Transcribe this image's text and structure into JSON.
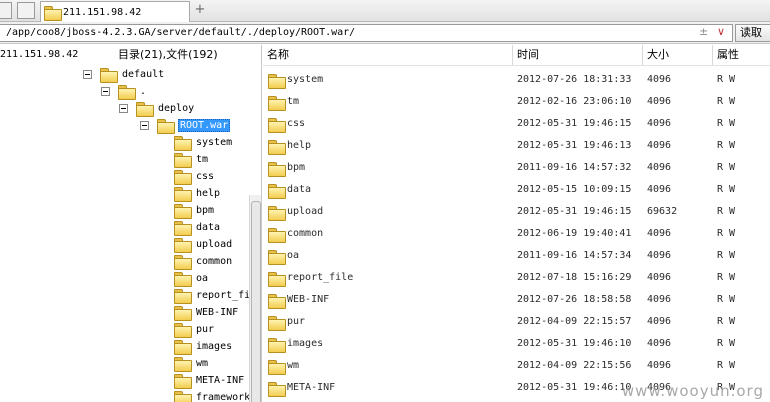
{
  "tabbar": {
    "tab_title": "211.151.98.42",
    "add_label": "+"
  },
  "address": {
    "path": "/app/coo8/jboss-4.2.3.GA/server/default/./deploy/ROOT.war/",
    "plusminus": "±",
    "dropdown": "∨",
    "read_label": "读取"
  },
  "left": {
    "host": "211.151.98.42",
    "counts": "目录(21),文件(192)",
    "tree": [
      {
        "label": "default",
        "expander": true,
        "selected": false
      },
      {
        "label": ".",
        "expander": true,
        "selected": false
      },
      {
        "label": "deploy",
        "expander": true,
        "selected": false
      },
      {
        "label": "ROOT.war",
        "expander": true,
        "selected": true
      },
      {
        "label": "system",
        "expander": false,
        "selected": false
      },
      {
        "label": "tm",
        "expander": false,
        "selected": false
      },
      {
        "label": "css",
        "expander": false,
        "selected": false
      },
      {
        "label": "help",
        "expander": false,
        "selected": false
      },
      {
        "label": "bpm",
        "expander": false,
        "selected": false
      },
      {
        "label": "data",
        "expander": false,
        "selected": false
      },
      {
        "label": "upload",
        "expander": false,
        "selected": false
      },
      {
        "label": "common",
        "expander": false,
        "selected": false
      },
      {
        "label": "oa",
        "expander": false,
        "selected": false
      },
      {
        "label": "report_fi",
        "expander": false,
        "selected": false
      },
      {
        "label": "WEB-INF",
        "expander": false,
        "selected": false
      },
      {
        "label": "pur",
        "expander": false,
        "selected": false
      },
      {
        "label": "images",
        "expander": false,
        "selected": false
      },
      {
        "label": "wm",
        "expander": false,
        "selected": false
      },
      {
        "label": "META-INF",
        "expander": false,
        "selected": false
      },
      {
        "label": "framework",
        "expander": false,
        "selected": false
      }
    ]
  },
  "list": {
    "columns": [
      "名称",
      "时间",
      "大小",
      "属性"
    ],
    "rows": [
      {
        "name": "system",
        "time": "2012-07-26 18:31:33",
        "size": "4096",
        "attr": "R W"
      },
      {
        "name": "tm",
        "time": "2012-02-16 23:06:10",
        "size": "4096",
        "attr": "R W"
      },
      {
        "name": "css",
        "time": "2012-05-31 19:46:15",
        "size": "4096",
        "attr": "R W"
      },
      {
        "name": "help",
        "time": "2012-05-31 19:46:13",
        "size": "4096",
        "attr": "R W"
      },
      {
        "name": "bpm",
        "time": "2011-09-16 14:57:32",
        "size": "4096",
        "attr": "R W"
      },
      {
        "name": "data",
        "time": "2012-05-15 10:09:15",
        "size": "4096",
        "attr": "R W"
      },
      {
        "name": "upload",
        "time": "2012-05-31 19:46:15",
        "size": "69632",
        "attr": "R W"
      },
      {
        "name": "common",
        "time": "2012-06-19 19:40:41",
        "size": "4096",
        "attr": "R W"
      },
      {
        "name": "oa",
        "time": "2011-09-16 14:57:34",
        "size": "4096",
        "attr": "R W"
      },
      {
        "name": "report_file",
        "time": "2012-07-18 15:16:29",
        "size": "4096",
        "attr": "R W"
      },
      {
        "name": "WEB-INF",
        "time": "2012-07-26 18:58:58",
        "size": "4096",
        "attr": "R W"
      },
      {
        "name": "pur",
        "time": "2012-04-09 22:15:57",
        "size": "4096",
        "attr": "R W"
      },
      {
        "name": "images",
        "time": "2012-05-31 19:46:10",
        "size": "4096",
        "attr": "R W"
      },
      {
        "name": "wm",
        "time": "2012-04-09 22:15:56",
        "size": "4096",
        "attr": "R W"
      },
      {
        "name": "META-INF",
        "time": "2012-05-31 19:46:10",
        "size": "4096",
        "attr": "R W"
      }
    ]
  },
  "watermark": "www.wooyun.org",
  "colors": {
    "selection": "#3399ff",
    "folder": "#f2cd4f"
  },
  "icons": {
    "folder": "folder-icon",
    "expander": "collapse-toggle"
  }
}
